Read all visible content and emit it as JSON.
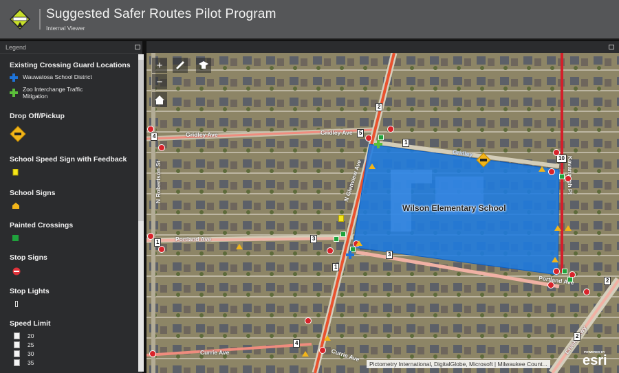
{
  "header": {
    "title": "Suggested Safer Routes Pilot Program",
    "subtitle": "Internal Viewer",
    "logo": "safe-routes-badge"
  },
  "legend": {
    "title": "Legend",
    "sections": [
      {
        "title": "Existing Crossing Guard Locations",
        "items": [
          {
            "label": "Wauwatosa School District",
            "icon": "blue-plus",
            "color": "#1e73d8"
          },
          {
            "label": "Zoo Interchange Traffic Mitigation",
            "icon": "green-plus",
            "color": "#5bbf3a"
          }
        ]
      },
      {
        "title": "Drop Off/Pickup",
        "icon": "yellow-diamond-car",
        "color": "#f2b51a"
      },
      {
        "title": "School Speed Sign with Feedback",
        "icon": "yellow-square",
        "color": "#f5e61a"
      },
      {
        "title": "School Signs",
        "icon": "school-sign-triangle",
        "color": "#f2b51a"
      },
      {
        "title": "Painted Crossings",
        "icon": "green-square",
        "color": "#1fa23c"
      },
      {
        "title": "Stop Signs",
        "icon": "stop-sign",
        "color": "#d8232a"
      },
      {
        "title": "Stop Lights",
        "icon": "traffic-light"
      },
      {
        "title": "Speed Limit",
        "items": [
          "20",
          "25",
          "30",
          "35"
        ]
      }
    ]
  },
  "map": {
    "tools": {
      "zoom_in": "+",
      "zoom_out": "−",
      "home": "home",
      "measure": "ruler",
      "education": "mortarboard"
    },
    "school_label": "Wilson Elementary School",
    "school_fill": "#1e7be0",
    "streets": [
      "Gridley Ave",
      "Gridley Ave",
      "Gridley",
      "N Robertson St",
      "N Glenview Ave",
      "Portland Ave",
      "Portland Ave",
      "Currie Ave",
      "Currie Ave",
      "Kavanaugh Pl",
      "Creek Pkwy"
    ],
    "route_numbers": [
      "4",
      "5",
      "1",
      "2",
      "1",
      "3",
      "3",
      "1",
      "4",
      "10",
      "2",
      "2"
    ],
    "attribution": "Pictometry International, DigitalGlobe, Microsoft | Milwaukee Count...",
    "esri_powered": "POWERED BY",
    "esri_brand": "esri"
  }
}
